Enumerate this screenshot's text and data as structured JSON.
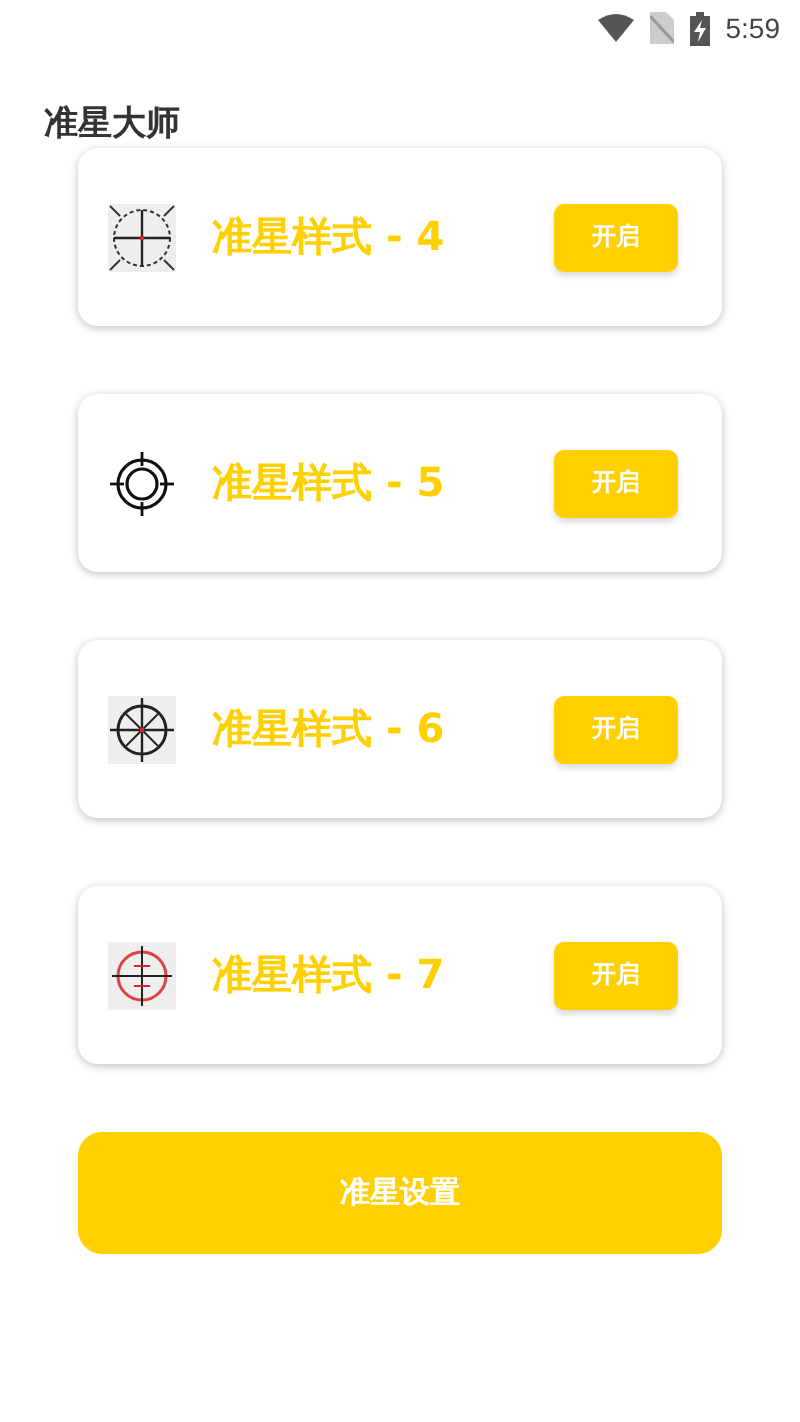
{
  "status_bar": {
    "time": "5:59"
  },
  "title": "准星大师",
  "styles": [
    {
      "kind": "grid",
      "label": "准星样式 - 4",
      "button": "开启"
    },
    {
      "kind": "rings",
      "label": "准星样式 - 5",
      "button": "开启"
    },
    {
      "kind": "spokes",
      "label": "准星样式 - 6",
      "button": "开启"
    },
    {
      "kind": "red",
      "label": "准星样式 - 7",
      "button": "开启"
    }
  ],
  "settings_button": "准星设置"
}
